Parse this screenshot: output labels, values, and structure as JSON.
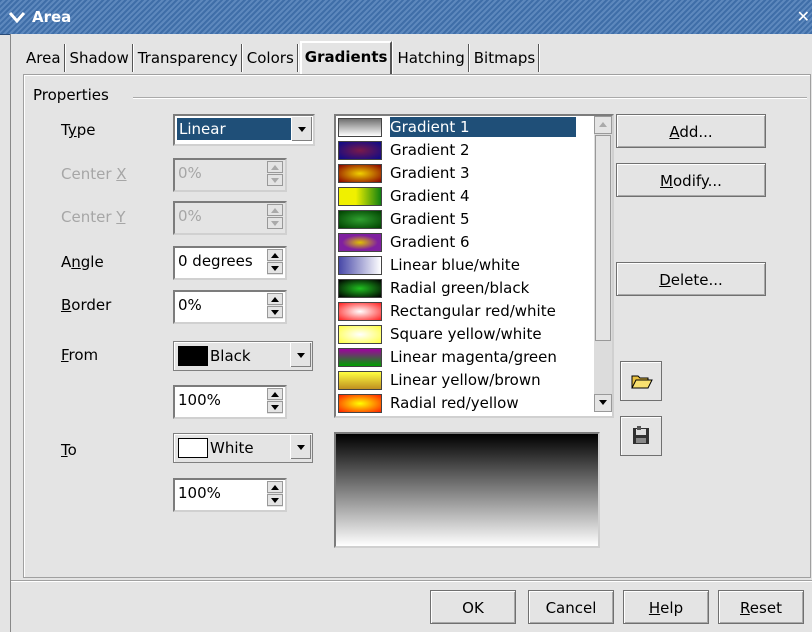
{
  "window": {
    "title": "Area"
  },
  "tabs": [
    {
      "label": "Area"
    },
    {
      "label": "Shadow"
    },
    {
      "label": "Transparency"
    },
    {
      "label": "Colors"
    },
    {
      "label": "Gradients",
      "active": true
    },
    {
      "label": "Hatching"
    },
    {
      "label": "Bitmaps"
    }
  ],
  "properties": {
    "group_title": "Properties",
    "type": {
      "label_pre": "T",
      "label_u": "y",
      "label_post": "pe",
      "value": "Linear"
    },
    "center_x": {
      "label_pre": "Center ",
      "label_u": "X",
      "value": "0%"
    },
    "center_y": {
      "label_pre": "Center ",
      "label_u": "Y",
      "value": "0%"
    },
    "angle": {
      "label_pre": "A",
      "label_u": "n",
      "label_post": "gle",
      "value": "0 degrees"
    },
    "border": {
      "label_u": "B",
      "label_post": "order",
      "value": "0%"
    },
    "from": {
      "label_u": "F",
      "label_post": "rom",
      "color_name": "Black",
      "color": "#000000",
      "intensity": "100%"
    },
    "to": {
      "label_u": "T",
      "label_post": "o",
      "color_name": "White",
      "color": "#ffffff",
      "intensity": "100%"
    }
  },
  "gradients": [
    {
      "name": "Gradient 1",
      "swatch": "linear-gradient(#707070,#ffffff)",
      "selected": true
    },
    {
      "name": "Gradient 2",
      "swatch": "radial-gradient(#7a1a4a,#0a0a8a)"
    },
    {
      "name": "Gradient 3",
      "swatch": "radial-gradient(#f0d000,#8a0000)"
    },
    {
      "name": "Gradient 4",
      "swatch": "linear-gradient(90deg,#f0f000,#f0f000 40%,#108010)"
    },
    {
      "name": "Gradient 5",
      "swatch": "radial-gradient(#30a030,#004000)"
    },
    {
      "name": "Gradient 6",
      "swatch": "radial-gradient(#e0c000,#8020a0 60%)"
    },
    {
      "name": "Linear blue/white",
      "swatch": "linear-gradient(90deg,#4848a8,#ffffff)"
    },
    {
      "name": "Radial green/black",
      "swatch": "radial-gradient(#20c020,#000000)"
    },
    {
      "name": "Rectangular red/white",
      "swatch": "radial-gradient(#ffffff,#ff2020)"
    },
    {
      "name": "Square yellow/white",
      "swatch": "radial-gradient(#ffffff,#ffff40)"
    },
    {
      "name": "Linear magenta/green",
      "swatch": "linear-gradient(#a000a0,#00a000)"
    },
    {
      "name": "Linear yellow/brown",
      "swatch": "linear-gradient(#ffff40,#c09020)"
    },
    {
      "name": "Radial red/yellow",
      "swatch": "radial-gradient(#ffff00,#ff2000)"
    }
  ],
  "preview": {
    "from": "#000000",
    "to": "#ffffff"
  },
  "buttons": {
    "add": {
      "pre": "",
      "u": "A",
      "post": "dd..."
    },
    "modify": {
      "pre": "",
      "u": "M",
      "post": "odify..."
    },
    "delete": {
      "pre": "",
      "u": "D",
      "post": "elete..."
    },
    "ok": "OK",
    "cancel": "Cancel",
    "help": {
      "u": "H",
      "post": "elp"
    },
    "reset": {
      "u": "R",
      "post": "eset"
    }
  },
  "icons": {
    "load": "open-folder-icon",
    "save": "save-icon",
    "window_menu": "chevron-down-icon",
    "close": "close-icon"
  }
}
